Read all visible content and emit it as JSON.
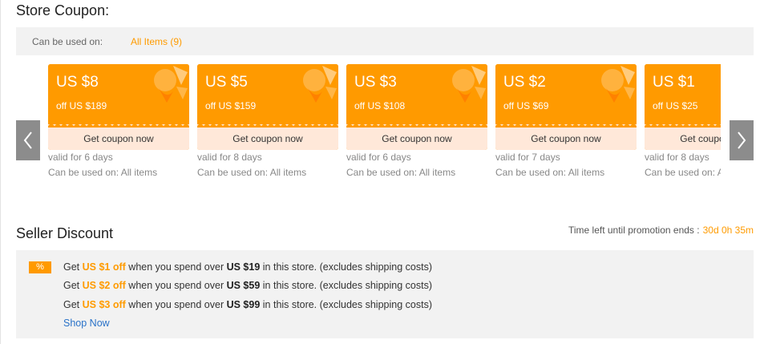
{
  "store_coupon": {
    "title": "Store Coupon:",
    "usable_label": "Can be used on:",
    "usable_value": "All Items (9)",
    "coupons": [
      {
        "amount": "US $8",
        "min_spend": "off US $189",
        "button": "Get coupon now",
        "validity": "valid for 6 days",
        "used_on": "Can be used on: All items"
      },
      {
        "amount": "US $5",
        "min_spend": "off US $159",
        "button": "Get coupon now",
        "validity": "valid for 8 days",
        "used_on": "Can be used on: All items"
      },
      {
        "amount": "US $3",
        "min_spend": "off US $108",
        "button": "Get coupon now",
        "validity": "valid for 6 days",
        "used_on": "Can be used on: All items"
      },
      {
        "amount": "US $2",
        "min_spend": "off US $69",
        "button": "Get coupon now",
        "validity": "valid for 7 days",
        "used_on": "Can be used on: All items"
      },
      {
        "amount": "US $1",
        "min_spend": "off US $25",
        "button": "Get coupon now",
        "validity": "valid for 8 days",
        "used_on": "Can be used on: All items"
      }
    ],
    "prev_icon": "chevron-left-icon",
    "next_icon": "chevron-right-icon"
  },
  "seller_discount": {
    "title": "Seller Discount",
    "time_left_label": "Time left until promotion ends :",
    "time_left_value": "30d 0h 35m",
    "badge": "%",
    "lines": [
      {
        "pre": "Get ",
        "off": "US $1 off",
        "mid": " when you spend over ",
        "threshold": "US $19",
        "post": " in this store. (excludes shipping costs)"
      },
      {
        "pre": "Get ",
        "off": "US $2 off",
        "mid": " when you spend over ",
        "threshold": "US $59",
        "post": " in this store. (excludes shipping costs)"
      },
      {
        "pre": "Get ",
        "off": "US $3 off",
        "mid": " when you spend over ",
        "threshold": "US $99",
        "post": " in this store. (excludes shipping costs)"
      }
    ],
    "shop_now": "Shop Now"
  },
  "colors": {
    "accent": "#ff9a00",
    "coupon_bottom": "#ffe8d9",
    "link": "#2a72c8",
    "panel": "#f2f2f2"
  }
}
